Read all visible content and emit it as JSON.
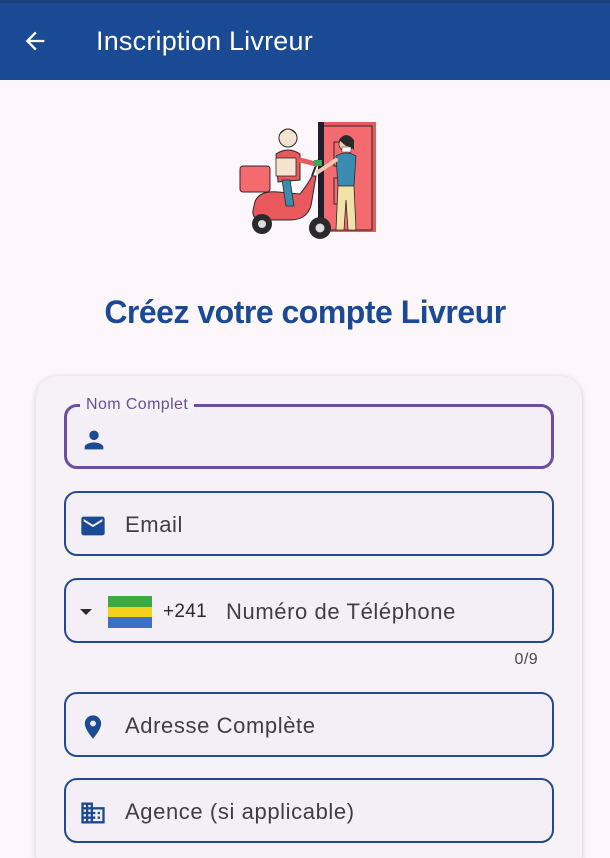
{
  "appbar": {
    "title": "Inscription Livreur",
    "back_icon": "arrow-left-icon",
    "color": "#1b4a94"
  },
  "hero": {
    "illustration": "delivery-scooter-illustration"
  },
  "heading": "Créez votre compte Livreur",
  "form": {
    "full_name": {
      "label": "Nom Complet",
      "value": "",
      "icon": "person-icon"
    },
    "email": {
      "placeholder": "Email",
      "value": "",
      "icon": "mail-icon"
    },
    "phone": {
      "country_flag": "gabon-flag",
      "flag_colors": [
        "#3aa843",
        "#f4d21c",
        "#3d6fc4"
      ],
      "dial_code": "+241",
      "placeholder": "Numéro de Téléphone",
      "value": "",
      "counter": "0/9"
    },
    "address": {
      "placeholder": "Adresse Complète",
      "value": "",
      "icon": "location-pin-icon"
    },
    "agency": {
      "placeholder": "Agence (si applicable)",
      "value": "",
      "icon": "building-icon"
    }
  },
  "colors": {
    "primary": "#1b4a94",
    "focus": "#6a4ea0",
    "background": "#fdf7fc"
  }
}
